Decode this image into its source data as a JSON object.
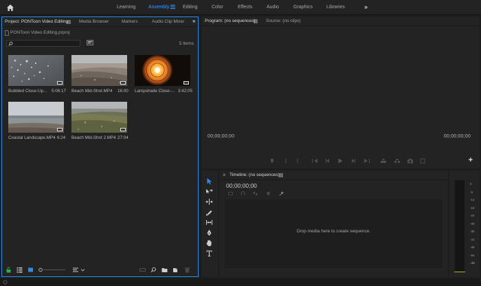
{
  "workspace_bar": {
    "tabs": [
      {
        "label": "Learning"
      },
      {
        "label": "Assembly"
      },
      {
        "label": "Editing"
      },
      {
        "label": "Color"
      },
      {
        "label": "Effects"
      },
      {
        "label": "Audio"
      },
      {
        "label": "Graphics"
      },
      {
        "label": "Libraries"
      }
    ],
    "active_tab": "Assembly",
    "overflow_glyph": "»"
  },
  "project_panel": {
    "tabs": [
      {
        "label": "Project: PONToon Video Editing"
      },
      {
        "label": "Media Browser"
      },
      {
        "label": "Markers"
      },
      {
        "label": "Audio Clip Mixer"
      }
    ],
    "overflow_glyph": "»",
    "project_file": "PONToon Video Editing.prproj",
    "search_placeholder": "",
    "items_count": "5 Items",
    "clips": [
      {
        "name": "Bubbled Close-Up...",
        "duration": "5:06:17",
        "thumb": "bubbles"
      },
      {
        "name": "Beach Mid-Shot.MP4",
        "duration": "16:00",
        "thumb": "beach"
      },
      {
        "name": "Lampshade Close-...",
        "duration": "3:42:05",
        "thumb": "lamp"
      },
      {
        "name": "Coastal Landscape.MP4",
        "duration": "6:24",
        "thumb": "coast"
      },
      {
        "name": "Beach Mid-Shot 2.MP4",
        "duration": "27:04",
        "thumb": "beach2"
      }
    ]
  },
  "program_panel": {
    "tabs": [
      {
        "label": "Program: (no sequences)"
      },
      {
        "label": "Source: (no clips)"
      }
    ],
    "timecode_left": "00;00;00;00",
    "timecode_right": "00;00;00;00",
    "add_button": "+"
  },
  "timeline_panel": {
    "title": "Timeline: (no sequences)",
    "close_glyph": "×",
    "timecode": "00;00;00;00",
    "drop_text": "Drop media here to create sequence."
  },
  "audio_meter": {
    "scale": [
      "0",
      "-6",
      "-12",
      "-18",
      "-24",
      "-30",
      "-36",
      "-42",
      "-48",
      "-54",
      "-dB"
    ]
  },
  "colors": {
    "accent": "#2d8ceb",
    "active_workspace": "#3f9bff",
    "panel_bg": "#232323",
    "app_bg": "#1d1d1d"
  }
}
